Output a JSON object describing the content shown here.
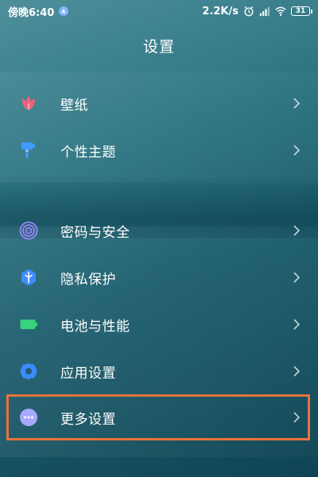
{
  "status_bar": {
    "time": "傍晚6:40",
    "speed": "2.2K/s",
    "battery": "31"
  },
  "header": {
    "title": "设置"
  },
  "menu": {
    "items": [
      {
        "label": "壁纸",
        "icon": "tulip-icon",
        "icon_color": "#f2607a"
      },
      {
        "label": "个性主题",
        "icon": "brush-icon",
        "icon_color": "#3f9bff"
      },
      {
        "label": "密码与安全",
        "icon": "fingerprint-icon",
        "icon_color": "#9b86ff"
      },
      {
        "label": "隐私保护",
        "icon": "privacy-shield-icon",
        "icon_color": "#3f8cff"
      },
      {
        "label": "电池与性能",
        "icon": "battery-icon",
        "icon_color": "#38d37a"
      },
      {
        "label": "应用设置",
        "icon": "gear-icon",
        "icon_color": "#3a8bff"
      },
      {
        "label": "更多设置",
        "icon": "more-dots-icon",
        "icon_color": "#a7a9ff"
      }
    ]
  },
  "colors": {
    "highlight": "#e8723c"
  }
}
